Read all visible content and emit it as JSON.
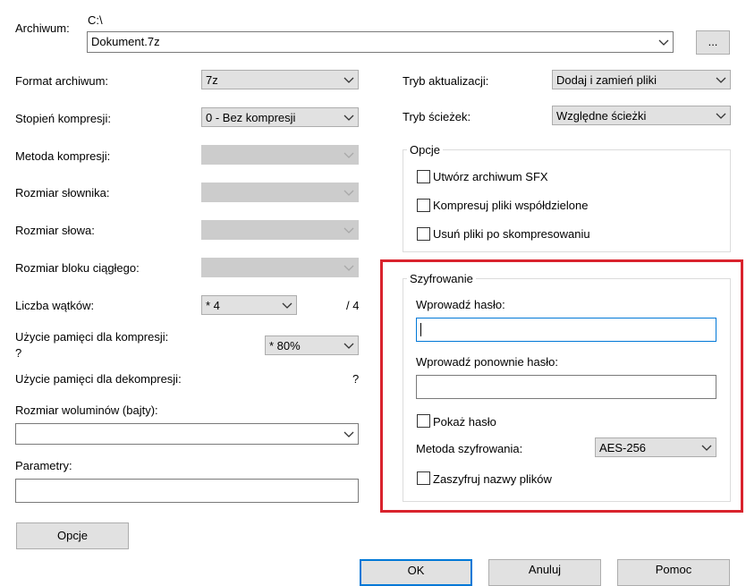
{
  "archive": {
    "label": "Archiwum:",
    "path": "C:\\",
    "filename": "Dokument.7z",
    "browse_label": "..."
  },
  "left": {
    "format_label": "Format archiwum:",
    "format_value": "7z",
    "level_label": "Stopień kompresji:",
    "level_value": "0 - Bez kompresji",
    "method_label": "Metoda kompresji:",
    "dict_label": "Rozmiar słownika:",
    "word_label": "Rozmiar słowa:",
    "block_label": "Rozmiar bloku ciągłego:",
    "threads_label": "Liczba wątków:",
    "threads_value": "* 4",
    "threads_max": "/ 4",
    "mem_comp_label": "Użycie pamięci dla kompresji:",
    "mem_comp_q": "?",
    "mem_comp_value": "* 80%",
    "mem_decomp_label": "Użycie pamięci dla dekompresji:",
    "mem_decomp_value": "?",
    "volumes_label": "Rozmiar woluminów (bajty):",
    "volumes_value": "",
    "params_label": "Parametry:",
    "params_value": "",
    "options_button": "Opcje"
  },
  "right": {
    "update_label": "Tryb aktualizacji:",
    "update_value": "Dodaj i zamień pliki",
    "paths_label": "Tryb ścieżek:",
    "paths_value": "Względne ścieżki",
    "options_group": "Opcje",
    "opt_sfx": "Utwórz archiwum SFX",
    "opt_shared": "Kompresuj pliki współdzielone",
    "opt_delete": "Usuń pliki po skompresowaniu"
  },
  "encryption": {
    "group": "Szyfrowanie",
    "password_label": "Wprowadź hasło:",
    "password_value": "",
    "repeat_label": "Wprowadź ponownie hasło:",
    "repeat_value": "",
    "show_password": "Pokaż hasło",
    "method_label": "Metoda szyfrowania:",
    "method_value": "AES-256",
    "encrypt_names": "Zaszyfruj nazwy plików",
    "highlight_color": "#d9232d"
  },
  "footer": {
    "ok": "OK",
    "cancel": "Anuluj",
    "help": "Pomoc"
  }
}
